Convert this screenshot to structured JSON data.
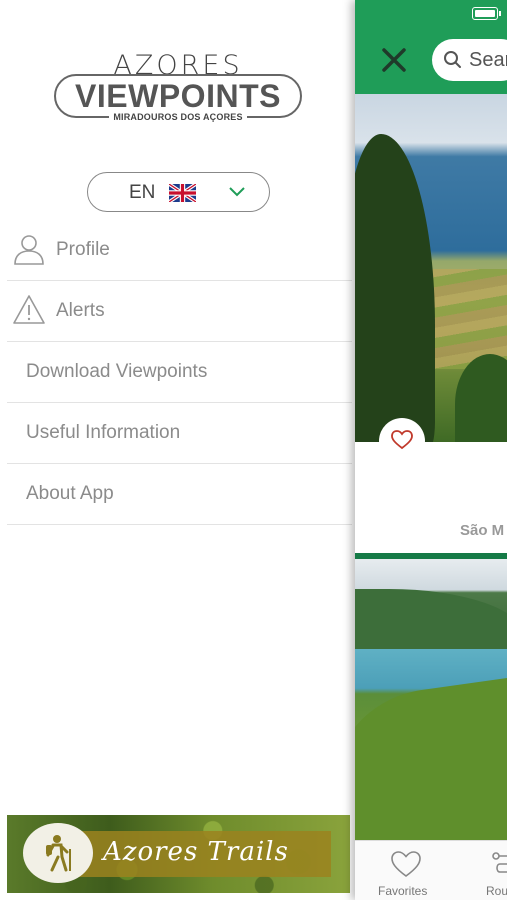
{
  "drawer": {
    "logo": {
      "top_text": "AZORES",
      "main_text": "VIEWPOINTS",
      "subtitle": "MIRADOUROS DOS AÇORES"
    },
    "language": {
      "code": "EN",
      "flag": "uk-flag-icon"
    },
    "menu": [
      {
        "label": "Profile",
        "icon": "user-icon"
      },
      {
        "label": "Alerts",
        "icon": "warning-icon"
      },
      {
        "label": "Download Viewpoints"
      },
      {
        "label": "Useful Information"
      },
      {
        "label": "About App"
      }
    ],
    "banner": {
      "text": "Azores Trails",
      "icon": "hiker-icon"
    }
  },
  "app": {
    "search_placeholder": "Search",
    "card": {
      "place": "São M"
    },
    "tabs": [
      {
        "label": "Favorites",
        "icon": "heart-icon"
      },
      {
        "label": "Rou",
        "icon": "route-icon"
      }
    ]
  },
  "colors": {
    "accent_green": "#1f9d58",
    "menu_text": "#8b8b8b",
    "heart_red": "#c0392b"
  }
}
